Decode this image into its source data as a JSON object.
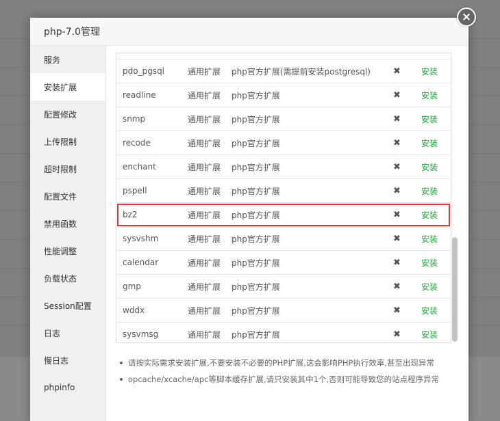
{
  "dialog": {
    "title": "php-7.0管理",
    "close_icon": "×"
  },
  "sidebar": {
    "items": [
      {
        "label": "服务"
      },
      {
        "label": "安装扩展"
      },
      {
        "label": "配置修改"
      },
      {
        "label": "上传限制"
      },
      {
        "label": "超时限制"
      },
      {
        "label": "配置文件"
      },
      {
        "label": "禁用函数"
      },
      {
        "label": "性能调整"
      },
      {
        "label": "负载状态"
      },
      {
        "label": "Session配置"
      },
      {
        "label": "日志"
      },
      {
        "label": "慢日志"
      },
      {
        "label": "phpinfo"
      }
    ],
    "active_index": 1
  },
  "extensions": {
    "rows": [
      {
        "name": "pdo_pgsql",
        "type": "通用扩展",
        "desc": "php官方扩展(需提前安装postgresql)",
        "status": "✖",
        "action": "安装"
      },
      {
        "name": "pdo_pgsql",
        "type": "通用扩展",
        "desc": "php官方扩展(需提前安装postgresql)",
        "status": "✖",
        "action": "安装"
      },
      {
        "name": "readline",
        "type": "通用扩展",
        "desc": "php官方扩展",
        "status": "✖",
        "action": "安装"
      },
      {
        "name": "snmp",
        "type": "通用扩展",
        "desc": "php官方扩展",
        "status": "✖",
        "action": "安装"
      },
      {
        "name": "recode",
        "type": "通用扩展",
        "desc": "php官方扩展",
        "status": "✖",
        "action": "安装"
      },
      {
        "name": "enchant",
        "type": "通用扩展",
        "desc": "php官方扩展",
        "status": "✖",
        "action": "安装"
      },
      {
        "name": "pspell",
        "type": "通用扩展",
        "desc": "php官方扩展",
        "status": "✖",
        "action": "安装"
      },
      {
        "name": "bz2",
        "type": "通用扩展",
        "desc": "php官方扩展",
        "status": "✖",
        "action": "安装"
      },
      {
        "name": "sysvshm",
        "type": "通用扩展",
        "desc": "php官方扩展",
        "status": "✖",
        "action": "安装"
      },
      {
        "name": "calendar",
        "type": "通用扩展",
        "desc": "php官方扩展",
        "status": "✖",
        "action": "安装"
      },
      {
        "name": "gmp",
        "type": "通用扩展",
        "desc": "php官方扩展",
        "status": "✖",
        "action": "安装"
      },
      {
        "name": "wddx",
        "type": "通用扩展",
        "desc": "php官方扩展",
        "status": "✖",
        "action": "安装"
      },
      {
        "name": "sysvmsg",
        "type": "通用扩展",
        "desc": "php官方扩展",
        "status": "✖",
        "action": "安装"
      }
    ],
    "highlighted_index": 7
  },
  "tips": [
    "请按实际需求安装扩展,不要安装不必要的PHP扩展,这会影响PHP执行效率,甚至出现异常",
    "opcache/xcache/apc等脚本缓存扩展,请只安装其中1个,否则可能导致您的站点程序异常"
  ],
  "colors": {
    "install_green": "#20a53a",
    "highlight_red": "#e53935"
  }
}
